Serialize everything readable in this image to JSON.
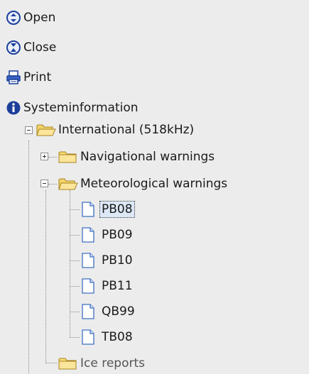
{
  "actions": {
    "open": "Open",
    "close": "Close",
    "print": "Print",
    "sysinfo": "Systeminformation"
  },
  "tree": {
    "root": "International (518kHz)",
    "nav": "Navigational warnings",
    "met": "Meteorological warnings",
    "items": [
      "PB08",
      "PB09",
      "PB10",
      "PB11",
      "QB99",
      "TB08"
    ],
    "ice": "Ice reports"
  }
}
